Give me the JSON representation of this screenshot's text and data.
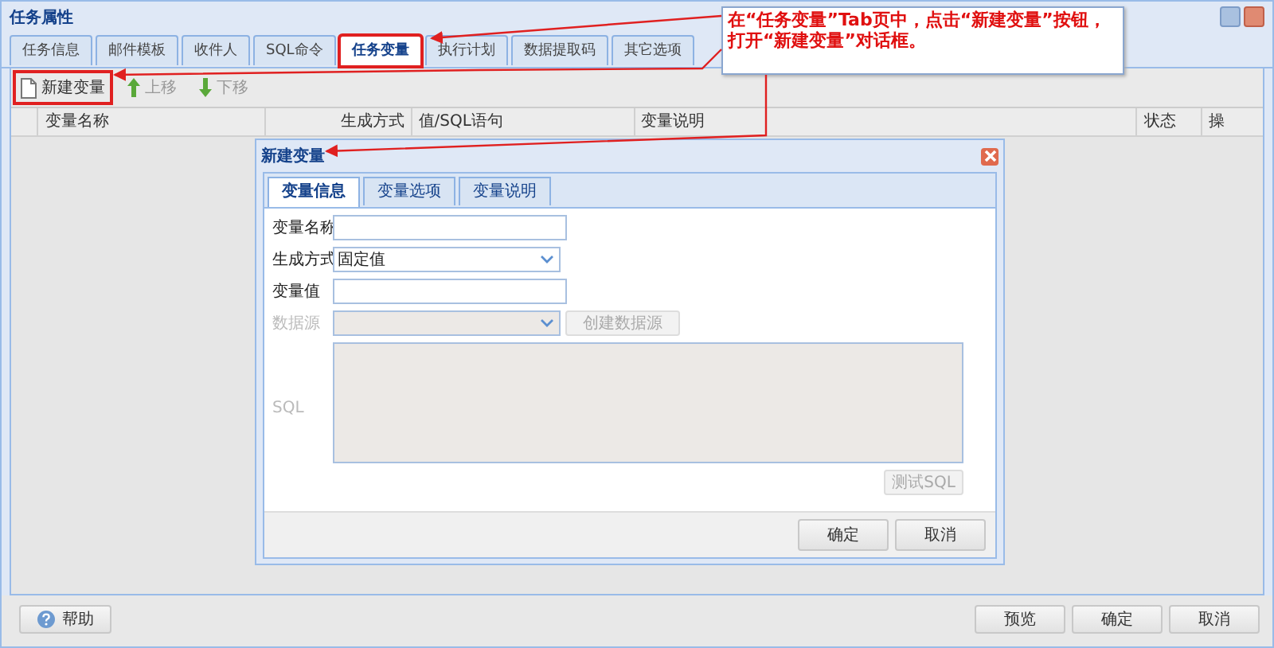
{
  "window": {
    "title": "任务属性"
  },
  "tabs": [
    {
      "label": "任务信息",
      "selected": false,
      "highlighted": false
    },
    {
      "label": "邮件模板",
      "selected": false,
      "highlighted": false
    },
    {
      "label": "收件人",
      "selected": false,
      "highlighted": false
    },
    {
      "label": "SQL命令",
      "selected": false,
      "highlighted": false
    },
    {
      "label": "任务变量",
      "selected": true,
      "highlighted": true
    },
    {
      "label": "执行计划",
      "selected": false,
      "highlighted": false
    },
    {
      "label": "数据提取码",
      "selected": false,
      "highlighted": false
    },
    {
      "label": "其它选项",
      "selected": false,
      "highlighted": false
    }
  ],
  "toolbar": [
    {
      "label": "新建变量",
      "kind": "new",
      "disabled": false,
      "highlighted": true
    },
    {
      "label": "上移",
      "kind": "up",
      "disabled": true,
      "highlighted": false
    },
    {
      "label": "下移",
      "kind": "down",
      "disabled": true,
      "highlighted": false
    }
  ],
  "table": {
    "columns": [
      "变量名称",
      "生成方式",
      "值/SQL语句",
      "变量说明",
      "状态",
      "操"
    ]
  },
  "dialog": {
    "title": "新建变量",
    "tabs": [
      {
        "label": "变量信息",
        "selected": true
      },
      {
        "label": "变量选项",
        "selected": false
      },
      {
        "label": "变量说明",
        "selected": false
      }
    ],
    "fields": [
      {
        "label": "变量名称",
        "kind": "text",
        "disabled": false
      },
      {
        "label": "生成方式",
        "kind": "select",
        "value": "固定值",
        "disabled": false
      },
      {
        "label": "变量值",
        "kind": "text",
        "disabled": false
      },
      {
        "label": "数据源",
        "kind": "select",
        "disabled": true,
        "button": "创建数据源"
      },
      {
        "label": "SQL",
        "kind": "textarea",
        "disabled": true,
        "button": "测试SQL"
      }
    ],
    "buttons": [
      "确定",
      "取消"
    ]
  },
  "footer": {
    "help": "帮助",
    "buttons": [
      "预览",
      "确定",
      "取消"
    ]
  },
  "annotation": {
    "lines": [
      "在“任务变量”Tab页中，点击“新建变量”按钮，",
      "打开“新建变量”对话框。"
    ]
  }
}
